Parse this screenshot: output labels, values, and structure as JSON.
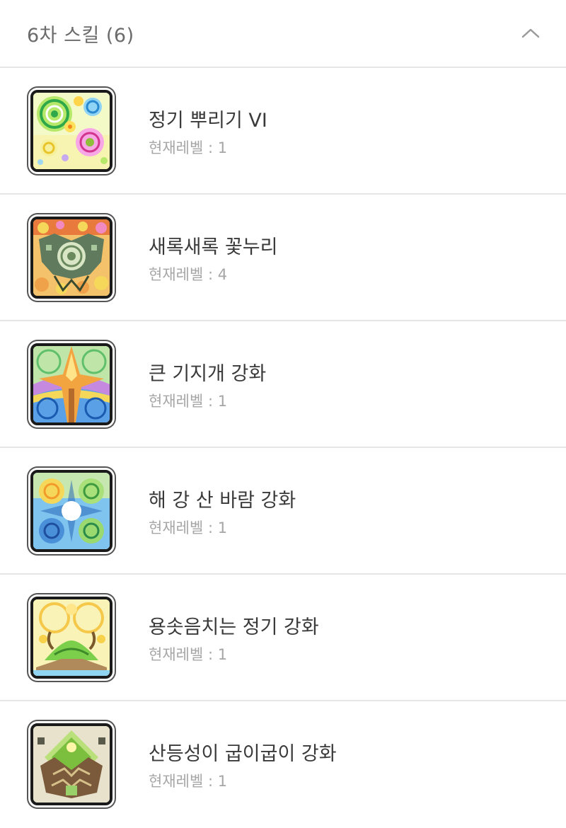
{
  "section": {
    "title": "6차 스킬 (6)",
    "toggle_icon": "chevron-up-icon",
    "divider_color": "#e6e6e6"
  },
  "skills": [
    {
      "name": "정기 뿌리기 VI",
      "level": "현재레벨 : 1",
      "icon": "spirit-scatter-icon"
    },
    {
      "name": "새록새록 꽃누리",
      "level": "현재레벨 : 4",
      "icon": "flower-world-icon"
    },
    {
      "name": "큰 기지개 강화",
      "level": "현재레벨 : 1",
      "icon": "big-stretch-icon"
    },
    {
      "name": "해 강 산 바람 강화",
      "level": "현재레벨 : 1",
      "icon": "sun-river-mountain-wind-icon"
    },
    {
      "name": "용솟음치는 정기 강화",
      "level": "현재레벨 : 1",
      "icon": "surging-spirit-icon"
    },
    {
      "name": "산등성이 굽이굽이 강화",
      "level": "현재레벨 : 1",
      "icon": "winding-ridge-icon"
    }
  ]
}
